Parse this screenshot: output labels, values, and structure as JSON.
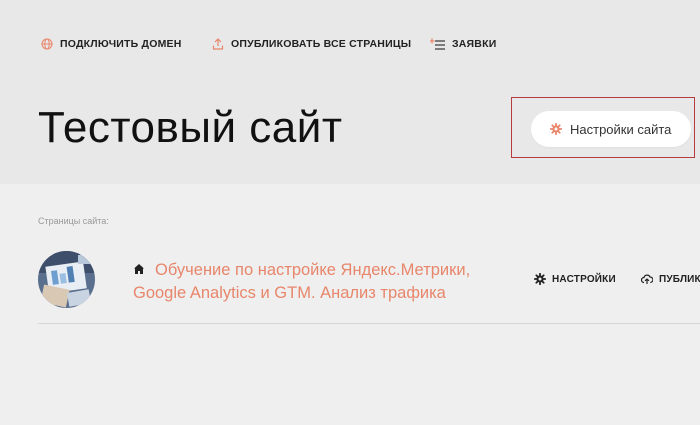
{
  "top_nav": {
    "connect_domain": "ПОДКЛЮЧИТЬ ДОМЕН",
    "publish_all": "ОПУБЛИКОВАТЬ ВСЕ СТРАНИЦЫ",
    "leads": "ЗАЯВКИ"
  },
  "site": {
    "title": "Тестовый сайт",
    "settings_button": "Настройки сайта"
  },
  "pages": {
    "section_label": "Страницы сайта:",
    "items": [
      {
        "title": "Обучение по настройке Яндекс.Метрики, Google Analytics и GTM. Анализ трафика",
        "settings_label": "НАСТРОЙКИ",
        "publish_label": "ПУБЛИКО"
      }
    ]
  },
  "colors": {
    "accent": "#e8866b",
    "highlight_border": "#b43c3c",
    "header_bg": "#e8e8e8",
    "page_bg": "#efefef"
  },
  "icons": {
    "connect_domain": "globe-icon",
    "publish_all": "upload-icon",
    "leads": "list-add-icon",
    "site_settings": "gear-icon",
    "page_home": "home-icon",
    "page_settings": "gear-icon",
    "page_publish": "cloud-upload-icon"
  }
}
